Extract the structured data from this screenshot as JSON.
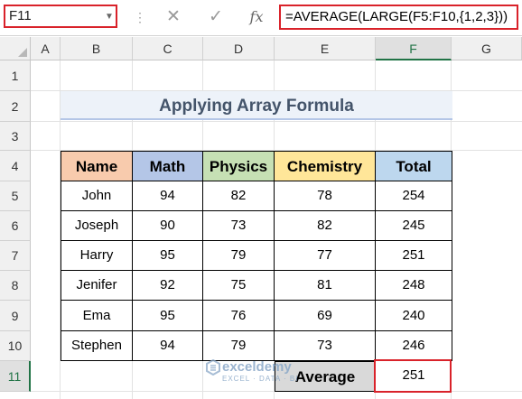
{
  "formula_bar": {
    "name_box": "F11",
    "cancel_icon": "✕",
    "enter_icon": "✓",
    "fx_label": "fx",
    "formula": "=AVERAGE(LARGE(F5:F10,{1,2,3}))"
  },
  "columns": [
    "A",
    "B",
    "C",
    "D",
    "E",
    "F",
    "G"
  ],
  "rows": [
    "1",
    "2",
    "3",
    "4",
    "5",
    "6",
    "7",
    "8",
    "9",
    "10",
    "11"
  ],
  "selected_cell": "F11",
  "title": "Applying Array Formula",
  "table": {
    "headers": [
      "Name",
      "Math",
      "Physics",
      "Chemistry",
      "Total"
    ],
    "header_colors": [
      "#f8cbad",
      "#b4c6e7",
      "#c6e0b4",
      "#ffe699",
      "#bdd7ee"
    ],
    "rows": [
      [
        "John",
        "94",
        "82",
        "78",
        "254"
      ],
      [
        "Joseph",
        "90",
        "73",
        "82",
        "245"
      ],
      [
        "Harry",
        "95",
        "79",
        "77",
        "251"
      ],
      [
        "Jenifer",
        "92",
        "75",
        "81",
        "248"
      ],
      [
        "Ema",
        "95",
        "76",
        "69",
        "240"
      ],
      [
        "Stephen",
        "94",
        "79",
        "73",
        "246"
      ]
    ],
    "average_label": "Average",
    "average_value": "251",
    "average_label_color": "#d9d9d9"
  },
  "watermark": {
    "name": "exceldemy",
    "tagline": "EXCEL · DATA · BI"
  },
  "accent_colors": {
    "highlight": "#d9222a",
    "selection": "#217346"
  }
}
